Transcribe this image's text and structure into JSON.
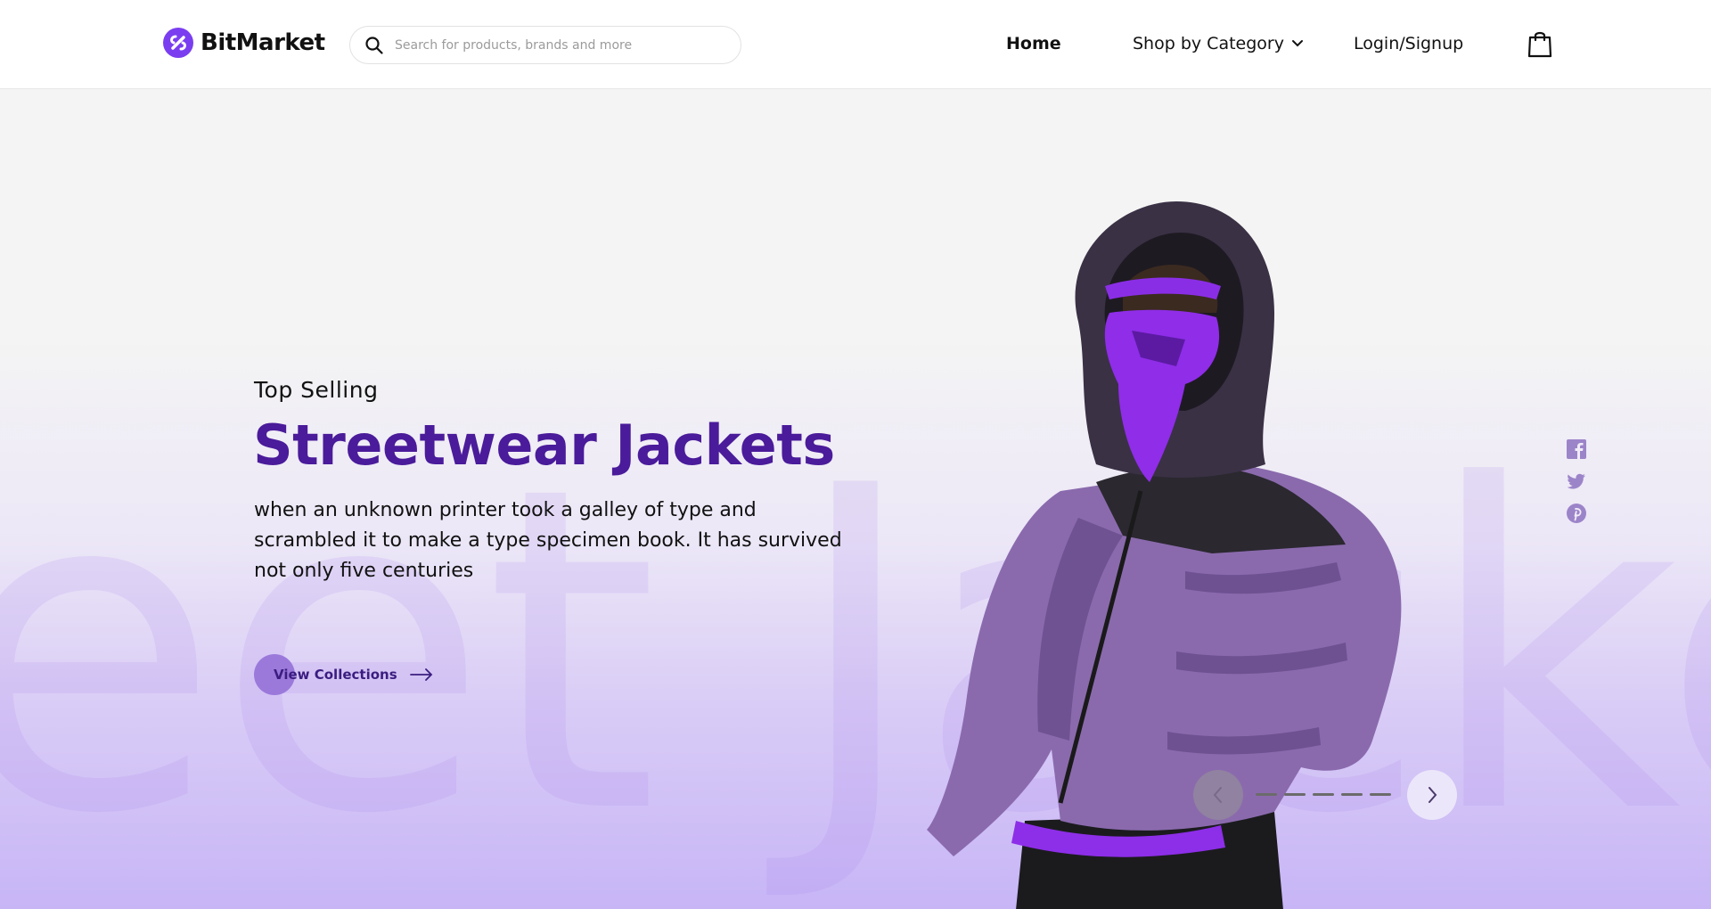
{
  "brand": {
    "name": "BitMarket",
    "accent": "#7a3ef0"
  },
  "search": {
    "placeholder": "Search for products, brands and more",
    "icon": "search-icon"
  },
  "nav": {
    "home": "Home",
    "category": "Shop by Category",
    "login": "Login/Signup",
    "cart_icon": "shopping-bag-icon"
  },
  "hero": {
    "kicker": "Top Selling",
    "title": "Streetwear Jackets",
    "description": "when an unknown printer took a galley of type and scrambled it to make a type specimen book. It has survived not only five centuries",
    "cta": "View Collections",
    "background_word": "eet Jacke",
    "title_color": "#4a1b9a"
  },
  "social": [
    "facebook-icon",
    "twitter-icon",
    "pinterest-icon"
  ],
  "carousel": {
    "prev_icon": "chevron-left-icon",
    "next_icon": "chevron-right-icon",
    "slides": 5
  }
}
